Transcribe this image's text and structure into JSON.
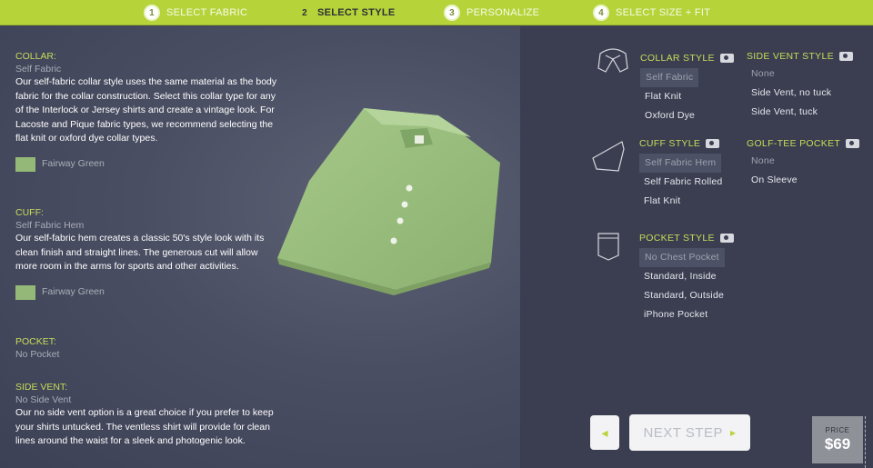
{
  "steps": [
    {
      "num": "1",
      "label": "SELECT FABRIC"
    },
    {
      "num": "2",
      "label": "SELECT STYLE"
    },
    {
      "num": "3",
      "label": "PERSONALIZE"
    },
    {
      "num": "4",
      "label": "SELECT SIZE + FIT"
    }
  ],
  "summary": {
    "collar": {
      "title": "COLLAR:",
      "value": "Self Fabric",
      "body": "Our self-fabric collar style uses the same material as the body fabric for the collar construction.  Select this collar type for any of the Interlock or Jersey shirts and create a vintage look.  For Lacoste and Pique fabric types, we recommend selecting the flat knit or oxford dye collar types.",
      "swatch_label": "Fairway Green",
      "swatch_color": "#94b878"
    },
    "cuff": {
      "title": "CUFF:",
      "value": "Self Fabric Hem",
      "body": "Our self-fabric hem creates a classic 50's style look with its clean finish and straight lines.  The generous cut will allow more room in the arms for sports and other activities.",
      "swatch_label": "Fairway Green",
      "swatch_color": "#94b878"
    },
    "pocket": {
      "title": "POCKET:",
      "value": "No Pocket"
    },
    "side_vent": {
      "title": "SIDE VENT:",
      "value": "No Side Vent",
      "body": "Our no side vent option is a great choice if you prefer to keep your shirts untucked.  The ventless shirt will provide for clean lines around the waist for a sleek and photogenic look."
    }
  },
  "options": {
    "collar_style": {
      "title": "COLLAR STYLE",
      "items": [
        "Self Fabric",
        "Flat Knit",
        "Oxford Dye"
      ],
      "selected": 0
    },
    "side_vent_style": {
      "title": "SIDE VENT STYLE",
      "items": [
        "None",
        "Side Vent, no tuck",
        "Side Vent, tuck"
      ],
      "selected": 0
    },
    "cuff_style": {
      "title": "CUFF STYLE",
      "items": [
        "Self Fabric Hem",
        "Self Fabric Rolled",
        "Flat Knit"
      ],
      "selected": 0
    },
    "golf_tee_pocket": {
      "title": "GOLF-TEE POCKET",
      "items": [
        "None",
        "On Sleeve"
      ],
      "selected": 0
    },
    "pocket_style": {
      "title": "POCKET STYLE",
      "items": [
        "No Chest Pocket",
        "Standard, Inside",
        "Standard, Outside",
        "iPhone Pocket"
      ],
      "selected": 0
    }
  },
  "nav": {
    "back_label": "◂",
    "next_label": "NEXT STEP",
    "next_arrow": "▸"
  },
  "price": {
    "label": "PRICE",
    "value": "$69"
  },
  "colors": {
    "accent": "#b6d33a",
    "shirt": "#94b878"
  }
}
